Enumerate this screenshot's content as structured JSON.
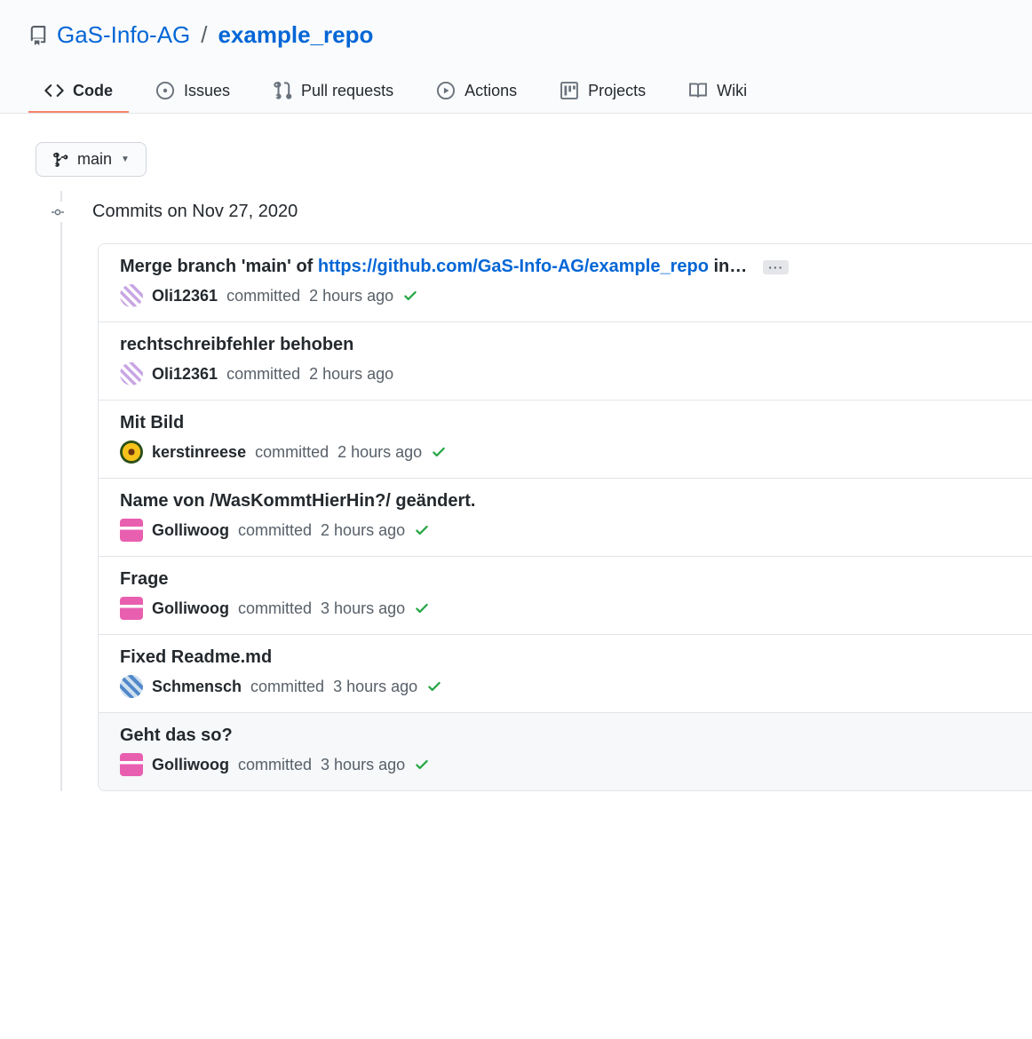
{
  "repo": {
    "owner": "GaS-Info-AG",
    "name": "example_repo"
  },
  "tabs": {
    "code": "Code",
    "issues": "Issues",
    "pulls": "Pull requests",
    "actions": "Actions",
    "projects": "Projects",
    "wiki": "Wiki"
  },
  "branch": {
    "name": "main"
  },
  "group_label": "Commits on Nov 27, 2020",
  "commits": [
    {
      "title_prefix": "Merge branch 'main' of ",
      "title_link": "https://github.com/GaS-Info-AG/example_repo",
      "title_suffix": " in…",
      "author": "Oli12361",
      "verb": "committed",
      "time": "2 hours ago",
      "has_check": true,
      "has_ellipsis": true,
      "avatar": "av-oli"
    },
    {
      "title": "rechtschreibfehler behoben",
      "author": "Oli12361",
      "verb": "committed",
      "time": "2 hours ago",
      "has_check": false,
      "avatar": "av-oli"
    },
    {
      "title": "Mit Bild",
      "author": "kerstinreese",
      "verb": "committed",
      "time": "2 hours ago",
      "has_check": true,
      "avatar": "av-kerstin"
    },
    {
      "title": "Name von /WasKommtHierHin?/ geändert.",
      "author": "Golliwoog",
      "verb": "committed",
      "time": "2 hours ago",
      "has_check": true,
      "avatar": "av-golli"
    },
    {
      "title": "Frage",
      "author": "Golliwoog",
      "verb": "committed",
      "time": "3 hours ago",
      "has_check": true,
      "avatar": "av-golli"
    },
    {
      "title": "Fixed Readme.md",
      "author": "Schmensch",
      "verb": "committed",
      "time": "3 hours ago",
      "has_check": true,
      "avatar": "av-schmensch"
    },
    {
      "title": "Geht das so?",
      "author": "Golliwoog",
      "verb": "committed",
      "time": "3 hours ago",
      "has_check": true,
      "avatar": "av-golli",
      "highlight": true
    }
  ]
}
